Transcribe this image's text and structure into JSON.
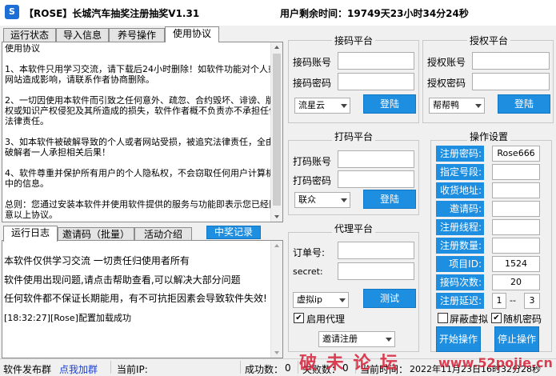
{
  "window": {
    "icon_text": "S",
    "title": "【ROSE】长城汽车抽奖注册抽奖V1.31",
    "remain_label": "用户剩余时间：",
    "remain_value": "19749天23小时34分24秒"
  },
  "top_tabs": [
    "运行状态",
    "导入信息",
    "养号操作",
    "使用协议"
  ],
  "agreement_text": "使用协议\n\n1、本软件只用学习交流，请下载后24小时删除！如软件功能对个人或网站造成影响，请联系作者协商删除。\n\n2、一切因使用本软件而引致之任何意外、疏忽、合约毁坏、诽谤、版权或知识产权侵犯及其所造成的损失，软件作者概不负责亦不承担任何法律责任。\n\n3、如本软件被破解导致的个人或者网站受损，被追究法律责任，全由破解者一人承担相关后果！\n\n4、软件尊重并保护所有用户的个人隐私权，不会窃取任何用户计算机中的信息。\n\n总则：您通过安装本软件并使用软件提供的服务与功能即表示您已经同意以上协议。",
  "bottom_tabs": [
    "运行日志",
    "邀请码（批量）",
    "活动介绍"
  ],
  "prize_button": "中奖记录",
  "log_lines": [
    "本软件仅供学习交流    一切责任归使用者所有",
    "软件使用出现问题,请点击帮助查看,可以解决大部分问题",
    "任何软件都不保证长期能用，有不可抗拒因素会导致软件失效!",
    "[18:32:27][Rose]配置加载成功"
  ],
  "receive": {
    "title": "接码平台",
    "account_label": "接码账号",
    "password_label": "接码密码",
    "account": "",
    "password": "",
    "platform": "流星云",
    "login": "登陆"
  },
  "auth": {
    "title": "授权平台",
    "account_label": "授权账号",
    "password_label": "授权密码",
    "account": "",
    "password": "",
    "platform": "帮帮鸭",
    "login": "登陆"
  },
  "captcha": {
    "title": "打码平台",
    "account_label": "打码账号",
    "password_label": "打码密码",
    "account": "",
    "password": "",
    "platform": "联众",
    "login": "登陆"
  },
  "proxy": {
    "title": "代理平台",
    "order_label": "订单号:",
    "secret_label": "secret:",
    "order": "",
    "secret": "",
    "type": "虚拟ip",
    "test": "测试",
    "enable_label": "启用代理",
    "enabled": true,
    "mode": "邀请注册"
  },
  "ops": {
    "title": "操作设置",
    "rows": [
      {
        "label": "注册密码:",
        "value": "Rose666"
      },
      {
        "label": "指定号段:",
        "value": ""
      },
      {
        "label": "收货地址:",
        "value": ""
      },
      {
        "label": "邀请码:",
        "value": ""
      },
      {
        "label": "注册线程:",
        "value": ""
      },
      {
        "label": "注册数量:",
        "value": ""
      },
      {
        "label": "项目ID:",
        "value": "1524"
      },
      {
        "label": "接码次数:",
        "value": "20"
      }
    ],
    "delay_label": "注册延迟:",
    "delay_min": "1",
    "delay_sep": "--",
    "delay_max": "3",
    "block_virtual_label": "屏蔽虚拟",
    "block_virtual": false,
    "random_pwd_label": "随机密码",
    "random_pwd": true,
    "start": "开始操作",
    "stop": "停止操作"
  },
  "status": {
    "publish": "软件发布群",
    "join": "点我加群",
    "ip_label": "当前IP:",
    "ip": "",
    "success_label": "成功数：",
    "success": "0",
    "fail_label": "失败数：",
    "fail": "0",
    "time_label": "当前时间：",
    "time": "2022年11月23日16时32分28秒"
  },
  "watermark": {
    "text": "破 未 论 坛",
    "url": "www.52pojie.cn"
  },
  "colors": {
    "accent": "#1e8ee0",
    "link": "#1a3fd6",
    "watermark": "#d7263d"
  }
}
